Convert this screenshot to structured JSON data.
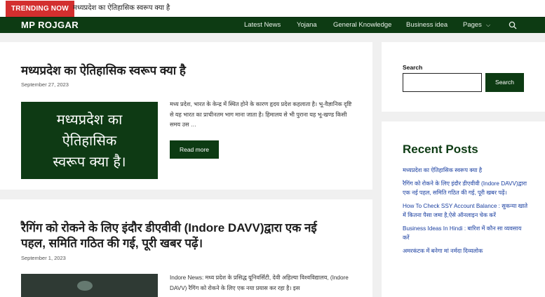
{
  "ticker": {
    "badge": "TRENDING NOW",
    "headline": "मध्यप्रदेश का ऐतिहासिक स्वरूप क्या है"
  },
  "nav": {
    "brand": "MP ROJGAR",
    "links": [
      "Latest News",
      "Yojana",
      "General Knowledge",
      "Business idea",
      "Pages"
    ]
  },
  "posts": [
    {
      "title": "मध्यप्रदेश का ऐतिहासिक स्वरूप क्या है",
      "date": "September 27, 2023",
      "thumb_lines": [
        "मध्यप्रदेश का",
        "ऐतिहासिक",
        "स्वरूप क्या है।"
      ],
      "excerpt": "मध्य प्रदेश, भारत के केन्द्र में स्थित होने के कारण हृदय प्रदेश कहलाता है। भू-वैज्ञानिक दृष्टि से यह भारत का प्राचीनतम भाग माना जाता है। हिमालय से भी पुराना यह भू-खण्ड किसी समय उस …",
      "button": "Read more"
    },
    {
      "title_line1": "रैगिंग को रोकने के लिए इंदौर डीएवीवी (Indore DAVV)द्वारा एक नई",
      "title_line2": "पहल, समिति गठित की गई, पूरी खबर पढ़ें।",
      "date": "September 1, 2023",
      "excerpt": "Indore News: मध्य प्रदेश के प्रसिद्ध यूनिवर्सिटी, देवी अहिल्या विश्वविद्यालय, (Indore DAVV) रैगिंग को रोकने के लिए एक नया प्रयास कर रहा है। इस"
    }
  ],
  "sidebar": {
    "search_label": "Search",
    "search_button": "Search",
    "recent_heading": "Recent Posts",
    "recent": [
      "मध्यप्रदेश का ऐतिहासिक स्वरूप क्या है",
      "रैगिंग को रोकने के लिए इंदौर डीएवीवी (Indore DAVV)द्वारा एक नई पहल, समिति गठित की गई, पूरी खबर पढ़ें।",
      "How To Check SSY Account Balance : सुकन्या खाते में कितना पैसा जमा है,ऐसे ऑनलाइन चेक करें",
      "Business Ideas In Hindi : बारिश में कौन सा व्यवसाय करें",
      "अमरकंटक में बनेगा मां नर्मदा दिव्यलोक"
    ]
  },
  "colors": {
    "nav_bg": "#0d3b13",
    "badge_bg": "#d32f2f",
    "link": "#1a3fa0"
  }
}
